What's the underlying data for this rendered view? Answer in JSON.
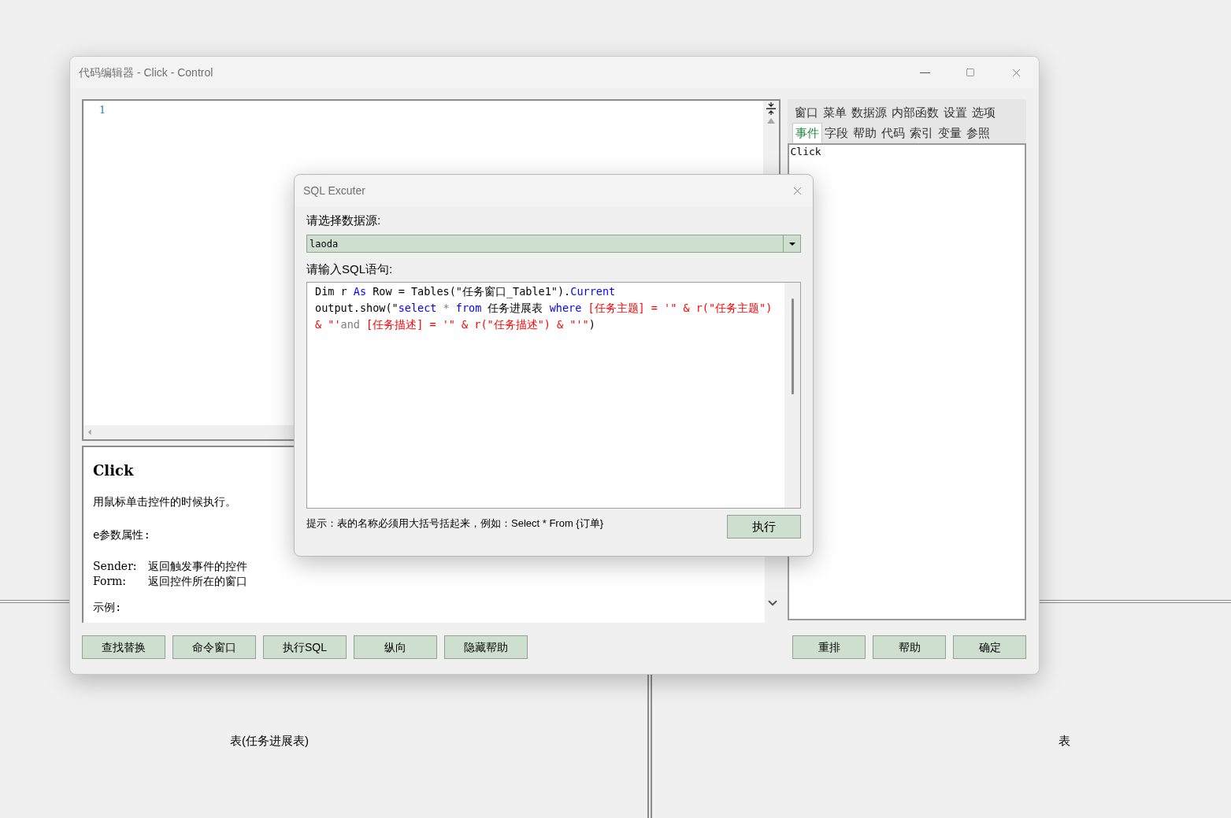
{
  "window": {
    "title": "代码编辑器 - Click - Control"
  },
  "editor": {
    "line_numbers": [
      "1"
    ]
  },
  "help": {
    "title": "Click",
    "description": "用鼠标单击控件的时候执行。",
    "section": "e参数属性:",
    "params": [
      {
        "name": "Sender:",
        "text": "返回触发事件的控件"
      },
      {
        "name": "Form:",
        "text": "返回控件所在的窗口"
      }
    ],
    "example_label": "示例:"
  },
  "side_tabs": [
    [
      {
        "label": "窗口",
        "selected": false
      },
      {
        "label": "菜单",
        "selected": false
      },
      {
        "label": "数据源",
        "selected": false
      },
      {
        "label": "内部函数",
        "selected": false
      },
      {
        "label": "设置",
        "selected": false
      },
      {
        "label": "选项",
        "selected": false
      }
    ],
    [
      {
        "label": "事件",
        "selected": true
      },
      {
        "label": "字段",
        "selected": false
      },
      {
        "label": "帮助",
        "selected": false
      },
      {
        "label": "代码",
        "selected": false
      },
      {
        "label": "索引",
        "selected": false
      },
      {
        "label": "变量",
        "selected": false
      },
      {
        "label": "参照",
        "selected": false
      }
    ]
  ],
  "event_list": [
    "Click"
  ],
  "buttons_left": [
    "查找替换",
    "命令窗口",
    "执行SQL",
    "纵向",
    "隐藏帮助"
  ],
  "buttons_right": [
    "重排",
    "帮助",
    "确定"
  ],
  "dialog": {
    "title": "SQL Excuter",
    "source_label": "请选择数据源:",
    "source_value": "laoda",
    "sql_label": "请输入SQL语句:",
    "code_lines": [
      [
        {
          "kind": "plain",
          "text": "Dim r "
        },
        {
          "kind": "keyword",
          "text": "As"
        },
        {
          "kind": "plain",
          "text": " Row = Tables(\"任务窗口_Table1\")."
        },
        {
          "kind": "keyword",
          "text": "Current"
        }
      ],
      [
        {
          "kind": "plain",
          "text": "output.show(\""
        },
        {
          "kind": "keyword",
          "text": "select"
        },
        {
          "kind": "operator",
          "text": " * "
        },
        {
          "kind": "keyword",
          "text": "from"
        },
        {
          "kind": "plain",
          "text": " 任务进展表 "
        },
        {
          "kind": "keyword",
          "text": "where"
        },
        {
          "kind": "string",
          "text": " [任务主题] = '\" & r(\"任务主题\") & \"'"
        },
        {
          "kind": "operator",
          "text": "and"
        },
        {
          "kind": "string",
          "text": " [任务描述] = '\" & r(\"任务描述\") & \"'\""
        },
        {
          "kind": "plain",
          "text": ")"
        }
      ]
    ],
    "hint": "提示：表的名称必须用大括号括起来，例如：Select * From {订单}",
    "execute_button": "执行"
  },
  "background": {
    "left_label": "表(任务进展表)",
    "right_label": "表"
  }
}
